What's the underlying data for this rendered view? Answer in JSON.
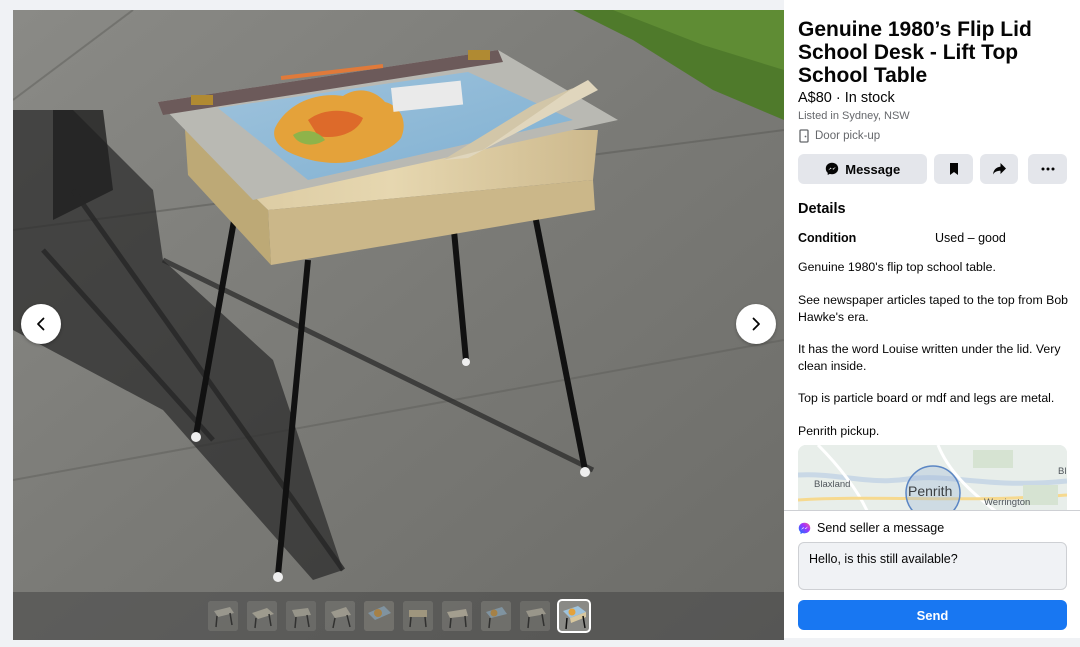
{
  "listing": {
    "title": "Genuine 1980’s Flip Lid School Desk - Lift Top School Table",
    "price_status": "A$80 · In stock",
    "listed_in": "Listed in Sydney, NSW",
    "delivery": "Door pick-up"
  },
  "actions": {
    "message_label": "Message",
    "save_icon": "bookmark-icon",
    "share_icon": "share-icon",
    "more_icon": "more-dots-icon"
  },
  "details": {
    "heading": "Details",
    "condition_label": "Condition",
    "condition_value": "Used – good",
    "description": [
      "Genuine 1980's flip top school table.",
      "See newspaper articles taped to the top from Bob Hawke's era.",
      "It has the word Louise written under the lid. Very clean inside.",
      "Top is particle board or mdf and legs are metal.",
      "Penrith pickup."
    ]
  },
  "map": {
    "labels": [
      "Blaxland",
      "Penrith",
      "Werrington",
      "Bl"
    ]
  },
  "send": {
    "header": "Send seller a message",
    "input_value": "Hello, is this still available?",
    "button_label": "Send"
  },
  "gallery": {
    "thumbnail_count": 10,
    "active_index": 9
  },
  "colors": {
    "accent": "#1877f2",
    "button_grey": "#e4e6eb",
    "secondary_text": "#65676b"
  }
}
